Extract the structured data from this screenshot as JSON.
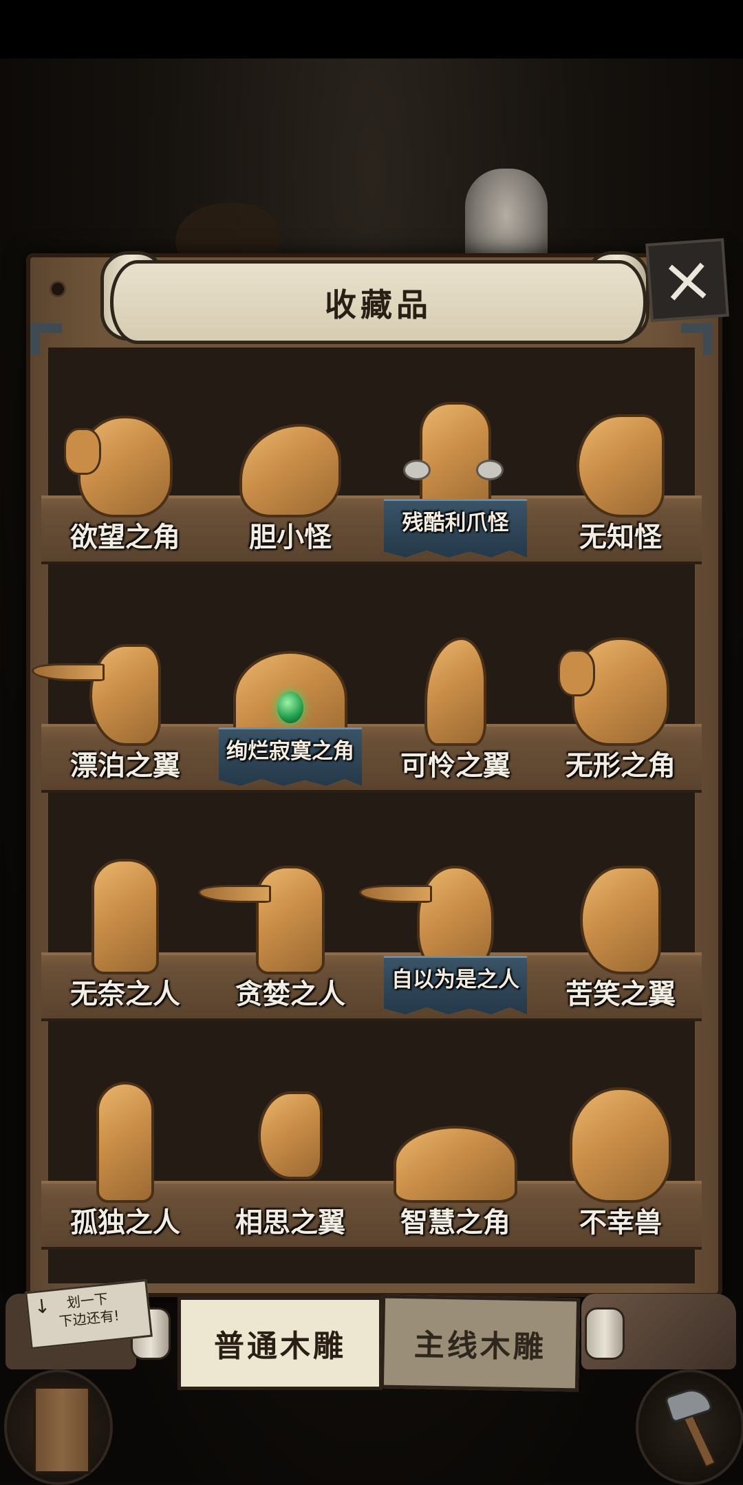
{
  "title": "收藏品",
  "close_label": "×",
  "hint": {
    "line1": "划一下",
    "line2": "下边还有!"
  },
  "tabs": [
    {
      "label": "普通木雕",
      "active": true
    },
    {
      "label": "主线木雕",
      "active": false
    }
  ],
  "shelves": [
    [
      {
        "name": "欲望之角",
        "rare": false
      },
      {
        "name": "胆小怪",
        "rare": false
      },
      {
        "name": "残酷利爪怪",
        "rare": true
      },
      {
        "name": "无知怪",
        "rare": false
      }
    ],
    [
      {
        "name": "漂泊之翼",
        "rare": false
      },
      {
        "name": "绚烂寂寞之角",
        "rare": true
      },
      {
        "name": "可怜之翼",
        "rare": false
      },
      {
        "name": "无形之角",
        "rare": false
      }
    ],
    [
      {
        "name": "无奈之人",
        "rare": false
      },
      {
        "name": "贪婪之人",
        "rare": false
      },
      {
        "name": "自以为是之人",
        "rare": true
      },
      {
        "name": "苦笑之翼",
        "rare": false
      }
    ],
    [
      {
        "name": "孤独之人",
        "rare": false
      },
      {
        "name": "相思之翼",
        "rare": false
      },
      {
        "name": "智慧之角",
        "rare": false
      },
      {
        "name": "不幸兽",
        "rare": false
      }
    ]
  ],
  "colors": {
    "wood_figure": "#d39a52",
    "rare_plate": "#2f4759",
    "gem": "#2fc25b"
  }
}
